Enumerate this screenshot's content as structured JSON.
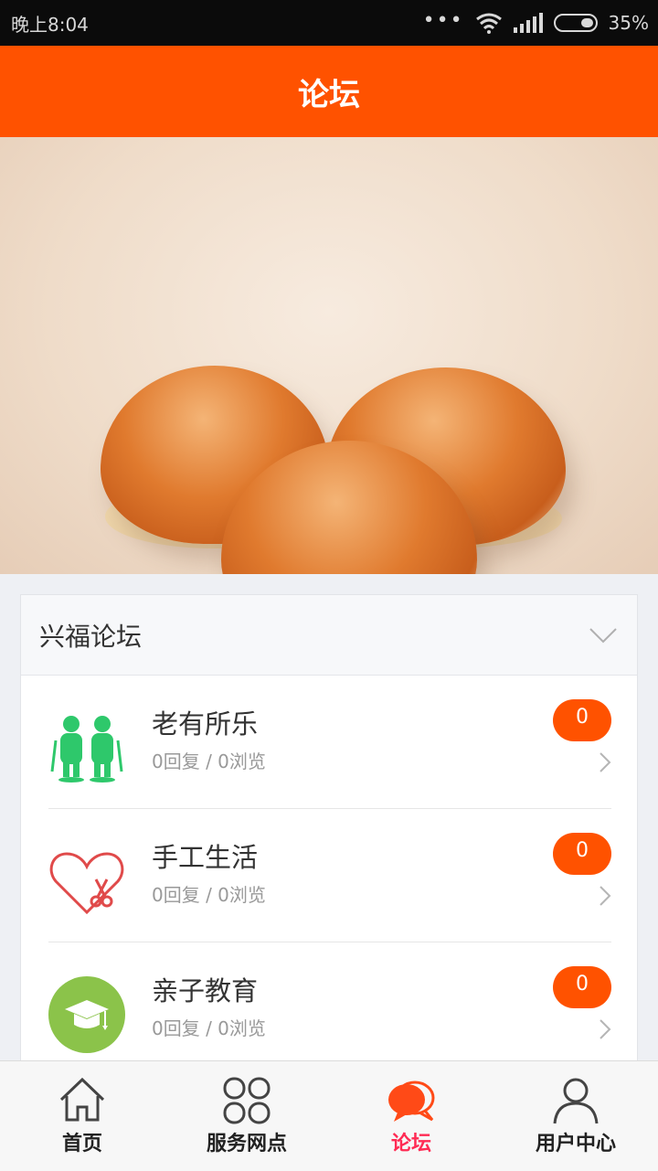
{
  "status_bar": {
    "time": "晚上8:04",
    "battery": "35%"
  },
  "header": {
    "title": "论坛"
  },
  "forum": {
    "title": "兴福论坛",
    "items": [
      {
        "title": "老有所乐",
        "meta": "0回复 / 0浏览",
        "badge": "0",
        "icon": "elderly-couple-icon"
      },
      {
        "title": "手工生活",
        "meta": "0回复 / 0浏览",
        "badge": "0",
        "icon": "heart-scissors-icon"
      },
      {
        "title": "亲子教育",
        "meta": "0回复 / 0浏览",
        "badge": "0",
        "icon": "graduation-cap-icon"
      }
    ]
  },
  "tabs": [
    {
      "label": "首页",
      "icon": "home-icon"
    },
    {
      "label": "服务网点",
      "icon": "grid-icon"
    },
    {
      "label": "论坛",
      "icon": "chat-bubbles-icon",
      "active": true
    },
    {
      "label": "用户中心",
      "icon": "user-icon"
    }
  ],
  "colors": {
    "brand": "#ff5200",
    "active_tab": "#ff2b54"
  }
}
